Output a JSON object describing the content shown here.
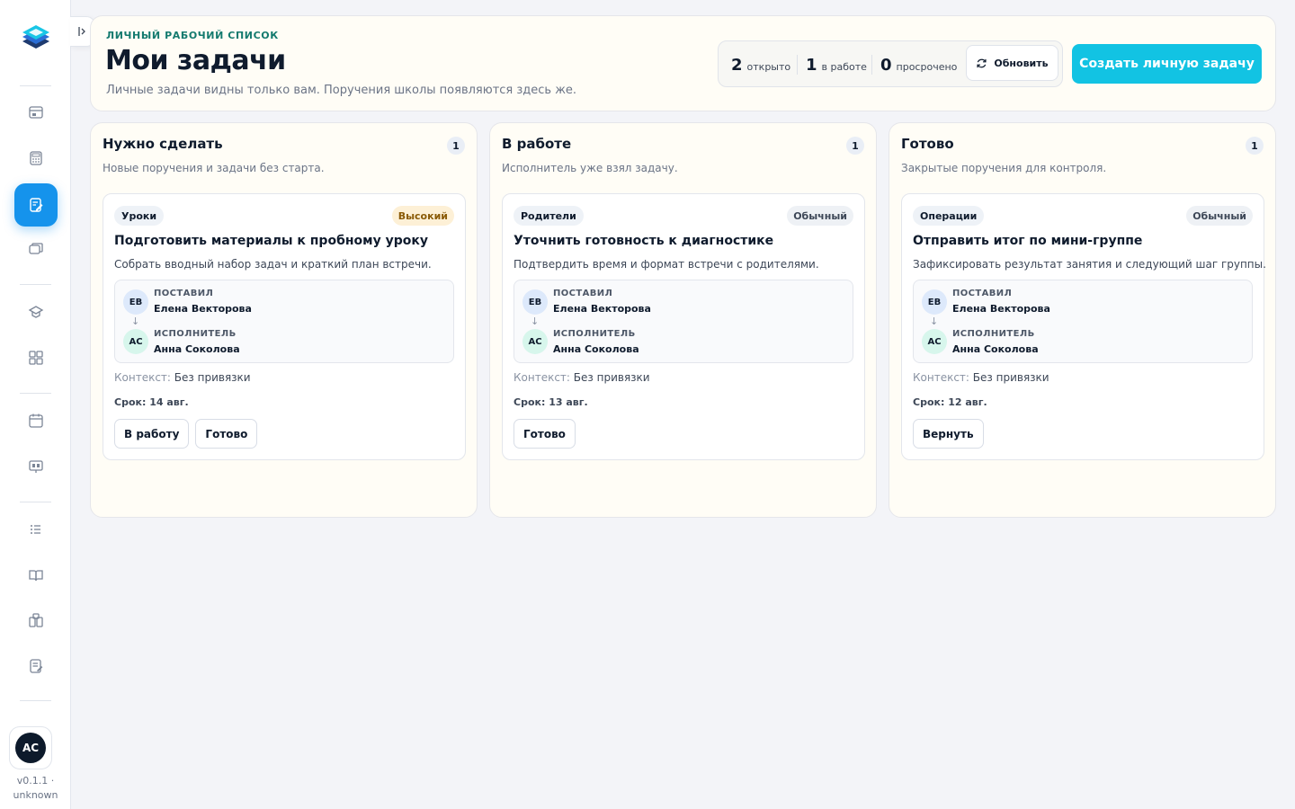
{
  "sidebar": {
    "version": "v0.1.1 ·",
    "version_label": "unknown",
    "user_initials": "AC",
    "items": [
      {
        "icon": "dashboard-icon"
      },
      {
        "icon": "calculator-icon"
      },
      {
        "icon": "task-edit-icon",
        "active": true
      },
      {
        "icon": "chat-icon"
      },
      {
        "icon": "school-icon"
      },
      {
        "icon": "groups-icon"
      },
      {
        "icon": "calendar-icon"
      },
      {
        "icon": "board-icon"
      },
      {
        "icon": "list-icon"
      },
      {
        "icon": "book-icon"
      },
      {
        "icon": "library-icon"
      },
      {
        "icon": "notes-icon"
      }
    ]
  },
  "header": {
    "eyebrow": "Личный рабочий список",
    "title": "Мои задачи",
    "subtitle": "Личные задачи видны только вам. Поручения школы появляются здесь же.",
    "stats": [
      {
        "value": "2",
        "label": "открыто"
      },
      {
        "value": "1",
        "label": "в работе"
      },
      {
        "value": "0",
        "label": "просрочено"
      }
    ],
    "refresh_label": "Обновить",
    "create_label": "Создать личную задачу"
  },
  "columns": [
    {
      "title": "Нужно сделать",
      "count": "1",
      "description": "Новые поручения и задачи без старта.",
      "task": {
        "tag": "Уроки",
        "priority": "Высокий",
        "title": "Подготовить материалы к пробному уроку",
        "description": "Собрать вводный набор задач и краткий план встречи.",
        "assigner_role": "Поставил",
        "assigner_initials": "ЕВ",
        "assigner_name": "Елена Векторова",
        "assignee_role": "Исполнитель",
        "assignee_initials": "АС",
        "assignee_name": "Анна Соколова",
        "context_key": "Контекст:",
        "context_value": "Без привязки",
        "deadline": "Срок: 14 авг.",
        "actions": [
          "В работу",
          "Готово"
        ]
      }
    },
    {
      "title": "В работе",
      "count": "1",
      "description": "Исполнитель уже взял задачу.",
      "task": {
        "tag": "Родители",
        "priority": "Обычный",
        "title": "Уточнить готовность к диагностике",
        "description": "Подтвердить время и формат встречи с родителями.",
        "assigner_role": "Поставил",
        "assigner_initials": "ЕВ",
        "assigner_name": "Елена Векторова",
        "assignee_role": "Исполнитель",
        "assignee_initials": "АС",
        "assignee_name": "Анна Соколова",
        "context_key": "Контекст:",
        "context_value": "Без привязки",
        "deadline": "Срок: 13 авг.",
        "actions": [
          "Готово"
        ]
      }
    },
    {
      "title": "Готово",
      "count": "1",
      "description": "Закрытые поручения для контроля.",
      "task": {
        "tag": "Операции",
        "priority": "Обычный",
        "title": "Отправить итог по мини-группе",
        "description": "Зафиксировать результат занятия и следующий шаг группы.",
        "assigner_role": "Поставил",
        "assigner_initials": "ЕВ",
        "assigner_name": "Елена Векторова",
        "assignee_role": "Исполнитель",
        "assignee_initials": "АС",
        "assignee_name": "Анна Соколова",
        "context_key": "Контекст:",
        "context_value": "Без привязки",
        "deadline": "Срок: 12 авг.",
        "actions": [
          "Вернуть"
        ]
      }
    }
  ],
  "colors": {
    "accent": "#12c3e3",
    "active_nav": "#1593ec",
    "eyebrow": "#137a6f",
    "priority_high_bg": "#fdf0d6"
  }
}
